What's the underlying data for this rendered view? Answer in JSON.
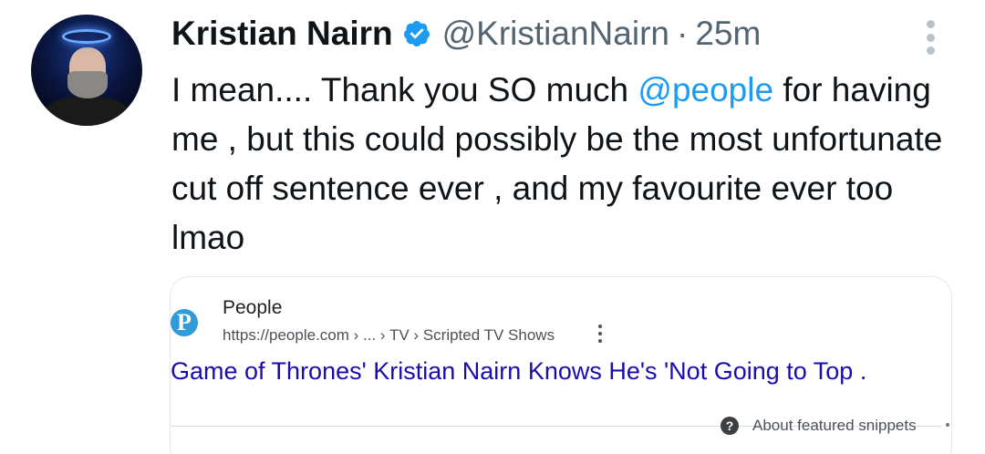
{
  "tweet": {
    "display_name": "Kristian Nairn",
    "handle": "@KristianNairn",
    "separator": "·",
    "time": "25m",
    "text_before": "I mean....   Thank you SO much ",
    "mention": "@people",
    "text_after": " for having me , but this could possibly be the most unfortunate cut off sentence ever , and my favourite ever too lmao"
  },
  "card": {
    "logo_letter": "P",
    "site_name": "People",
    "url": "https://people.com › ... › TV › Scripted TV Shows",
    "title": "Game of Thrones' Kristian Nairn Knows He's 'Not Going to Top .",
    "snippets_icon": "?",
    "snippets_label": "About featured snippets"
  },
  "colors": {
    "verified": "#1d9bf0",
    "mention": "#1d9bf0",
    "link_title": "#1a0dab",
    "muted": "#536471"
  },
  "icons": [
    "verified-badge-icon",
    "more-options-icon",
    "people-logo-icon",
    "kebab-menu-icon",
    "help-icon"
  ]
}
